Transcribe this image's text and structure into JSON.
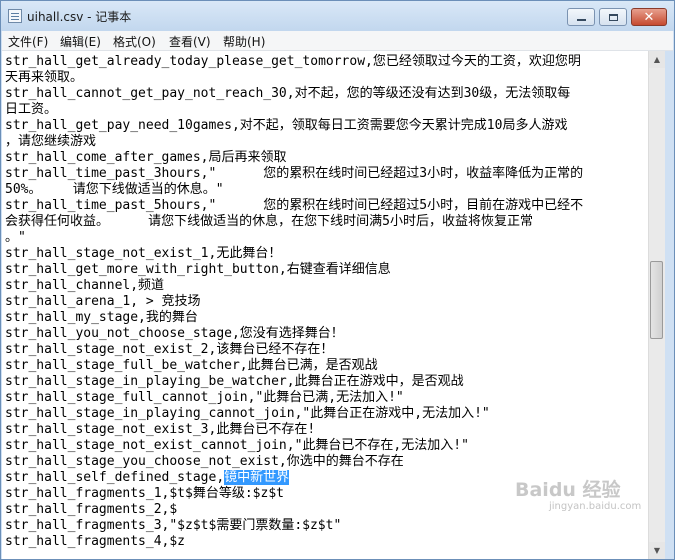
{
  "window": {
    "title": "uihall.csv - 记事本",
    "minimize_glyph": "",
    "maximize_glyph": "",
    "close_glyph": "✕"
  },
  "menu": [
    {
      "label": "文件(F)"
    },
    {
      "label": "编辑(E)"
    },
    {
      "label": "格式(O)"
    },
    {
      "label": "查看(V)"
    },
    {
      "label": "帮助(H)"
    }
  ],
  "editor": {
    "lines": [
      {
        "text": "str_hall_get_already_today_please_get_tomorrow,您已经领取过今天的工资，欢迎您明"
      },
      {
        "text": "天再来领取。"
      },
      {
        "text": "str_hall_cannot_get_pay_not_reach_30,对不起，您的等级还没有达到30级，无法领取每"
      },
      {
        "text": "日工资。"
      },
      {
        "text": "str_hall_get_pay_need_10games,对不起，领取每日工资需要您今天累计完成10局多人游戏"
      },
      {
        "text": "，请您继续游戏"
      },
      {
        "text": "str_hall_come_after_games,局后再来领取"
      },
      {
        "text": "str_hall_time_past_3hours,\"      您的累积在线时间已经超过3小时，收益率降低为正常的"
      },
      {
        "text": "50%。    请您下线做适当的休息。\""
      },
      {
        "text": "str_hall_time_past_5hours,\"      您的累积在线时间已经超过5小时，目前在游戏中已经不"
      },
      {
        "text": "会获得任何收益。     请您下线做适当的休息，在您下线时间满5小时后，收益将恢复正常"
      },
      {
        "text": "。\""
      },
      {
        "text": "str_hall_stage_not_exist_1,无此舞台！"
      },
      {
        "text": "str_hall_get_more_with_right_button,右键查看详细信息"
      },
      {
        "text": "str_hall_channel,频道"
      },
      {
        "text": "str_hall_arena_1, > 竞技场"
      },
      {
        "text": "str_hall_my_stage,我的舞台"
      },
      {
        "text": "str_hall_you_not_choose_stage,您没有选择舞台！"
      },
      {
        "text": "str_hall_stage_not_exist_2,该舞台已经不存在！"
      },
      {
        "text": "str_hall_stage_full_be_watcher,此舞台已满，是否观战"
      },
      {
        "text": "str_hall_stage_in_playing_be_watcher,此舞台正在游戏中，是否观战"
      },
      {
        "text": "str_hall_stage_full_cannot_join,\"此舞台已满,无法加入!\""
      },
      {
        "text": "str_hall_stage_in_playing_cannot_join,\"此舞台正在游戏中,无法加入!\""
      },
      {
        "text": "str_hall_stage_not_exist_3,此舞台已不存在!"
      },
      {
        "text": "str_hall_stage_not_exist_cannot_join,\"此舞台已不存在,无法加入!\""
      },
      {
        "text": "str_hall_stage_you_choose_not_exist,你选中的舞台不存在"
      },
      {
        "text": "str_hall_self_defined_stage,",
        "selected": "镜中新世界"
      },
      {
        "text": "str_hall_fragments_1,$t$舞台等级:$z$t"
      },
      {
        "text": "str_hall_fragments_2,$"
      },
      {
        "text": "str_hall_fragments_3,\"$z$t$需要门票数量:$z$t\""
      },
      {
        "text": "str_hall_fragments_4,$z"
      }
    ]
  },
  "scrollbar": {
    "up_glyph": "▲",
    "down_glyph": "▼"
  },
  "watermark": {
    "brand": "Baidu 经验",
    "url": "jingyan.baidu.com"
  }
}
